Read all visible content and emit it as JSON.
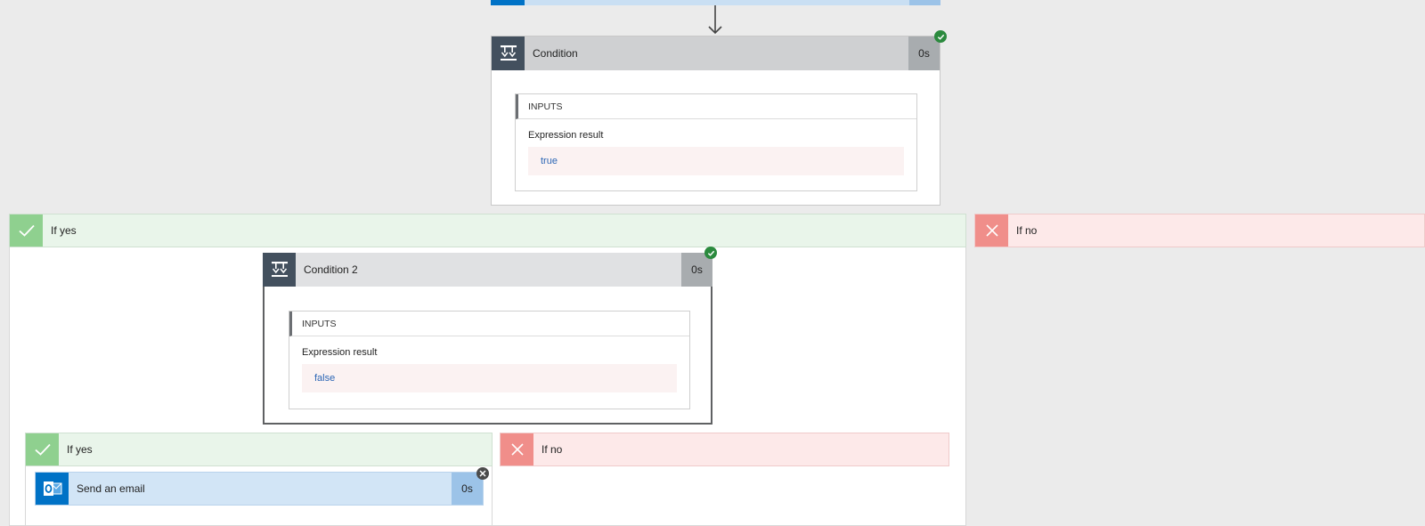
{
  "condition": {
    "title": "Condition",
    "duration": "0s",
    "inputs_header": "INPUTS",
    "expression_label": "Expression result",
    "expression_value": "true",
    "icon": "condition-icon",
    "status": "succeeded"
  },
  "outer_branches": {
    "yes_label": "If yes",
    "no_label": "If no"
  },
  "condition2": {
    "title": "Condition 2",
    "duration": "0s",
    "inputs_header": "INPUTS",
    "expression_label": "Expression result",
    "expression_value": "false",
    "icon": "condition-icon",
    "status": "succeeded"
  },
  "inner_branches": {
    "yes_label": "If yes",
    "no_label": "If no"
  },
  "send_email": {
    "title": "Send an email",
    "duration": "0s",
    "icon": "outlook-icon",
    "status": "skipped"
  },
  "colors": {
    "canvas": "#ebebeb",
    "yes_green": "#8fd08f",
    "no_red": "#f08e8a",
    "success": "#2b8a3e",
    "outlook_blue": "#0072c6"
  }
}
